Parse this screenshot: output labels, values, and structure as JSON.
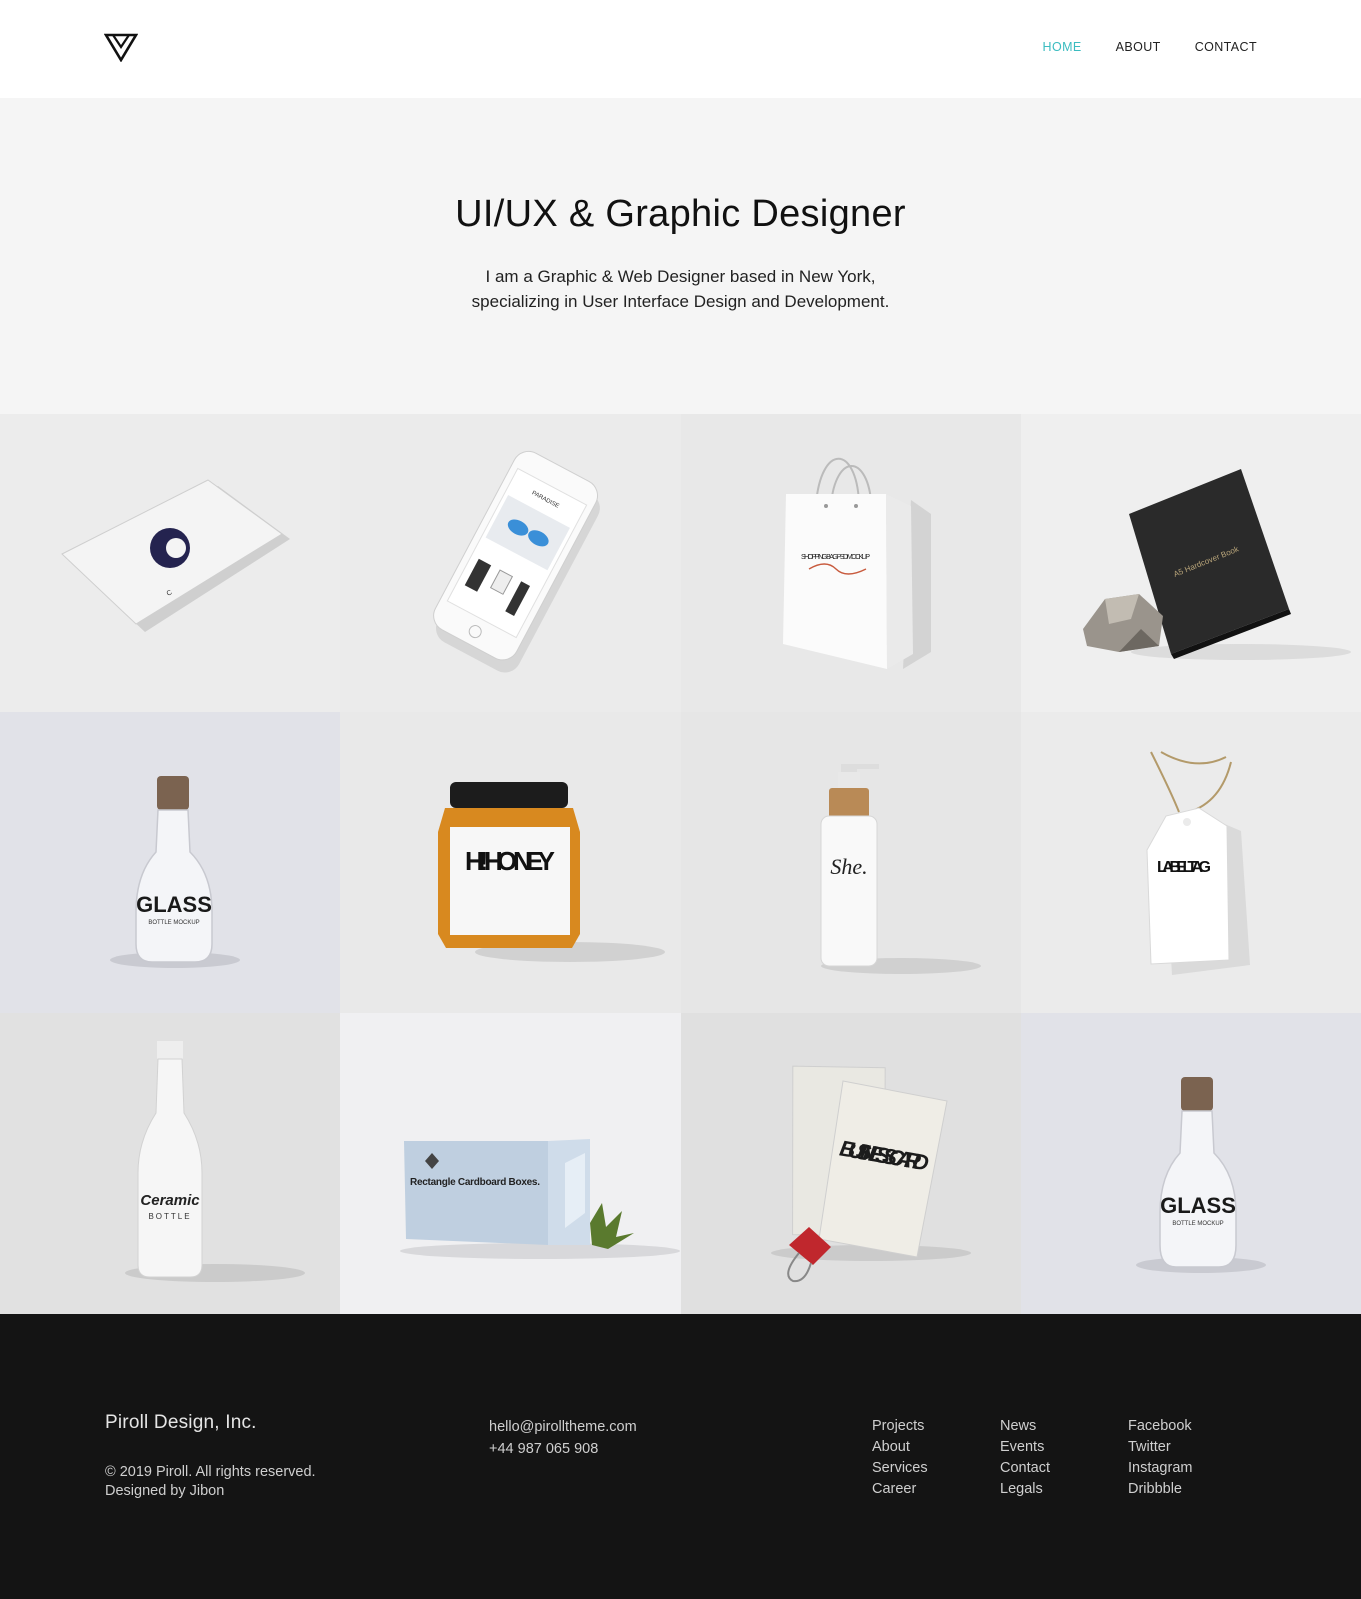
{
  "header": {
    "nav": [
      {
        "label": "HOME",
        "active": true
      },
      {
        "label": "ABOUT",
        "active": false
      },
      {
        "label": "CONTACT",
        "active": false
      }
    ],
    "accent_color": "#3bbcc0"
  },
  "hero": {
    "title": "UI/UX & Graphic Designer",
    "line1": "I am a Graphic & Web Designer based in New York,",
    "line2": "specializing in User Interface Design and Development."
  },
  "portfolio": {
    "tiles": [
      {
        "icon": "business-card-mockup-icon",
        "text": "C"
      },
      {
        "icon": "smartphone-mockup-icon",
        "text": "PARADISE"
      },
      {
        "icon": "shopping-bag-mockup-icon",
        "text": "SHOPPING BAG PSD MOCKUP"
      },
      {
        "icon": "hardcover-book-mockup-icon",
        "text": "A5 Hardcover Book"
      },
      {
        "icon": "glass-bottle-mockup-icon",
        "text": "GLASS",
        "sub": "BOTTLE MOCKUP"
      },
      {
        "icon": "honey-jar-mockup-icon",
        "text": "HI! HO NEY"
      },
      {
        "icon": "pump-bottle-mockup-icon",
        "text": "She."
      },
      {
        "icon": "label-tag-mockup-icon",
        "text": "LAB EL TAG"
      },
      {
        "icon": "ceramic-bottle-mockup-icon",
        "text": "Ceramic",
        "sub": "BOTTLE"
      },
      {
        "icon": "cardboard-box-mockup-icon",
        "text": "Rectangle Cardboard Boxes."
      },
      {
        "icon": "business-card-stack-icon",
        "text": "BUSI NESS CARD"
      },
      {
        "icon": "glass-bottle-mockup-icon",
        "text": "GLASS",
        "sub": "BOTTLE MOCKUP"
      }
    ]
  },
  "footer": {
    "brand": "Piroll Design, Inc.",
    "copyright": "© 2019 Piroll. All rights reserved.",
    "credit": "Designed by Jibon",
    "email": "hello@pirolltheme.com",
    "phone": "+44 987 065 908",
    "col1": [
      "Projects",
      "About",
      "Services",
      "Career"
    ],
    "col2": [
      "News",
      "Events",
      "Contact",
      "Legals"
    ],
    "col3": [
      "Facebook",
      "Twitter",
      "Instagram",
      "Dribbble"
    ]
  }
}
